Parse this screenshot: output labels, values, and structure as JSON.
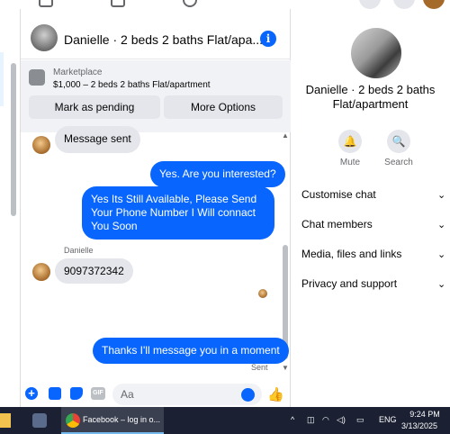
{
  "chat": {
    "title": "Danielle · 2 beds 2 baths Flat/apa...",
    "marketplace_label": "Marketplace",
    "listing": "$1,000 – 2 beds 2 baths Flat/apartment",
    "mark_pending": "Mark as pending",
    "more_options": "More Options",
    "messages": [
      {
        "text": "Message sent"
      },
      {
        "text": "Yes. Are you interested?"
      },
      {
        "text": "Yes Its Still Available, Please Send Your Phone Number I Will connact You Soon"
      },
      {
        "sender": "Danielle",
        "text": "9097372342"
      },
      {
        "text": "Thanks I'll message you in a moment"
      }
    ],
    "sent_status": "Sent",
    "composer_placeholder": "Aa",
    "gif_label": "GIF"
  },
  "panel": {
    "name": "Danielle · 2 beds 2 baths Flat/apartment",
    "mute": "Mute",
    "search": "Search",
    "rows": [
      "Customise chat",
      "Chat members",
      "Media, files and links",
      "Privacy and support"
    ]
  },
  "taskbar": {
    "app_label": "Facebook – log in o...",
    "lang": "ENG",
    "time": "9:24 PM",
    "date": "3/13/2025"
  },
  "colors": {
    "accent": "#0866ff",
    "bubble_in": "#e4e6eb",
    "taskbar": "#1b2133"
  }
}
